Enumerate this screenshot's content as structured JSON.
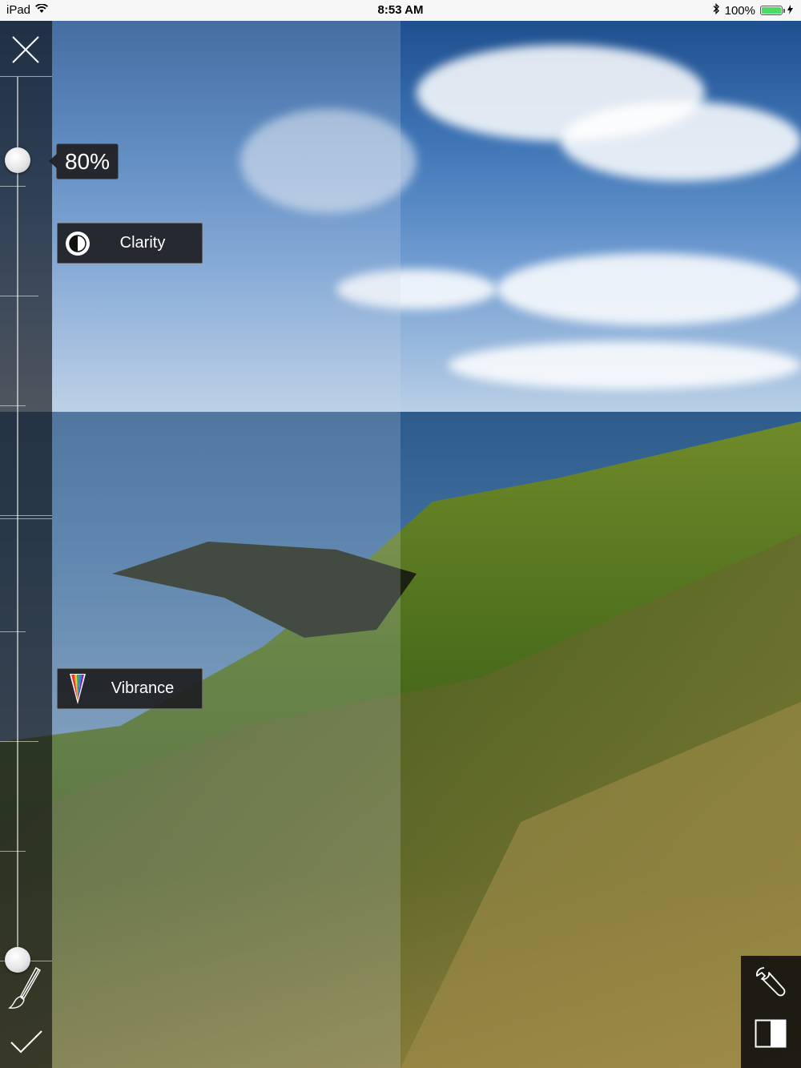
{
  "status_bar": {
    "device": "iPad",
    "time": "8:53 AM",
    "battery": "100%"
  },
  "slider": {
    "value_label": "80%",
    "upper_value_percent": 80
  },
  "adjustments": [
    {
      "label": "Clarity",
      "icon": "clarity-icon"
    },
    {
      "label": "Vibrance",
      "icon": "vibrance-icon"
    }
  ],
  "icons": {
    "close": "close-icon",
    "brush": "brush-icon",
    "confirm": "checkmark-icon",
    "tools": "wrench-icon",
    "compare": "split-compare-icon",
    "wifi": "wifi-icon",
    "bluetooth": "bluetooth-icon",
    "battery": "battery-icon"
  },
  "colors": {
    "panel": "#0a0a0c",
    "battery_fill": "#4cd964",
    "label_bg": "#1c1c1e"
  }
}
